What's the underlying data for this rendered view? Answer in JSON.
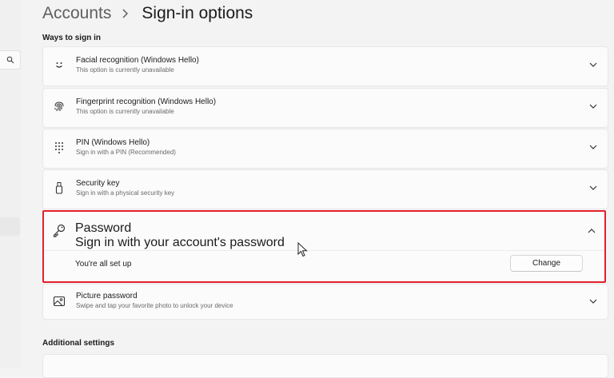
{
  "breadcrumb": {
    "parent": "Accounts",
    "current": "Sign-in options"
  },
  "sections": {
    "ways": "Ways to sign in",
    "additional": "Additional settings"
  },
  "options": [
    {
      "title": "Facial recognition (Windows Hello)",
      "desc": "This option is currently unavailable",
      "icon": "face-icon"
    },
    {
      "title": "Fingerprint recognition (Windows Hello)",
      "desc": "This option is currently unavailable",
      "icon": "fingerprint-icon"
    },
    {
      "title": "PIN (Windows Hello)",
      "desc": "Sign in with a PIN (Recommended)",
      "icon": "pin-keypad-icon"
    },
    {
      "title": "Security key",
      "desc": "Sign in with a physical security key",
      "icon": "usb-key-icon"
    },
    {
      "title": "Password",
      "desc": "Sign in with your account's password",
      "icon": "key-icon",
      "expanded": true,
      "status": "You're all set up",
      "action": "Change"
    },
    {
      "title": "Picture password",
      "desc": "Swipe and tap your favorite photo to unlock your device",
      "icon": "picture-icon"
    }
  ],
  "colors": {
    "highlight": "#e4202c",
    "background": "#f3f3f3",
    "card": "#fbfbfb"
  }
}
